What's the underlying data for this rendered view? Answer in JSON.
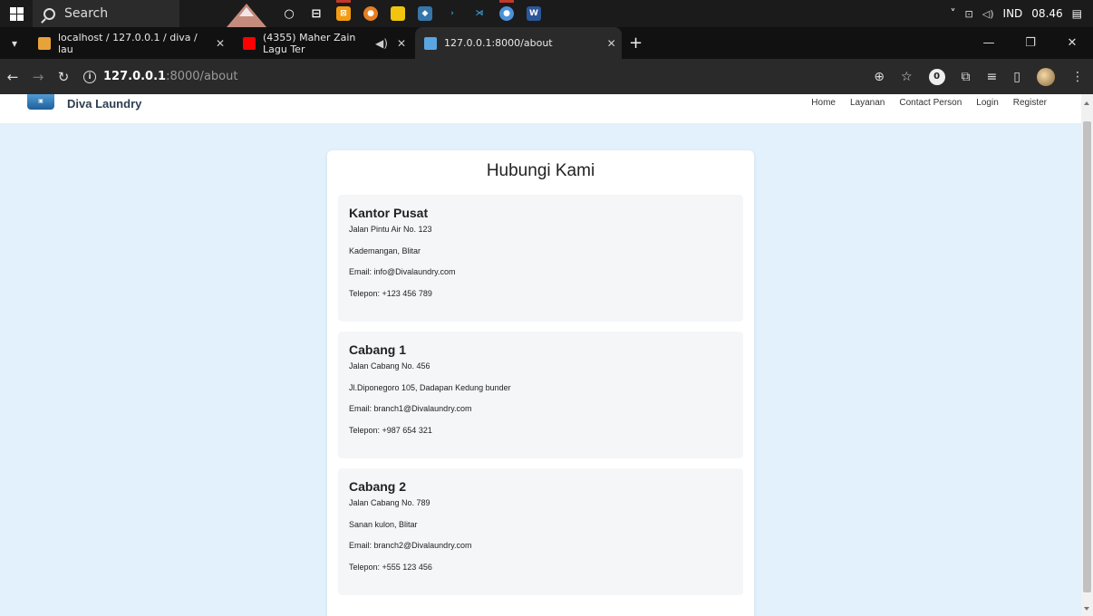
{
  "taskbar": {
    "search_placeholder": "Search",
    "tray_lang": "IND",
    "tray_time": "08.46"
  },
  "tabs": [
    {
      "label": "localhost / 127.0.0.1 / diva / lau",
      "favicon_color": "#e8a23a"
    },
    {
      "label": "(4355) Maher Zain Lagu Ter",
      "favicon_color": "#ff0000"
    },
    {
      "label": "127.0.0.1:8000/about",
      "favicon_color": "#5aa6e0"
    }
  ],
  "address_bar": {
    "url_host": "127.0.0.1",
    "url_rest": ":8000/about"
  },
  "site": {
    "brand_name": "Diva Laundry",
    "nav": [
      "Home",
      "Layanan",
      "Contact Person",
      "Login",
      "Register"
    ]
  },
  "contact": {
    "title": "Hubungi Kami",
    "offices": [
      {
        "name": "Kantor Pusat",
        "street": "Jalan Pintu Air No. 123",
        "area": "Kademangan, Blitar",
        "email": "Email: info@Divalaundry.com",
        "phone": "Telepon: +123 456 789"
      },
      {
        "name": "Cabang 1",
        "street": "Jalan Cabang No. 456",
        "area": "Jl.Diponegoro 105, Dadapan Kedung bunder",
        "email": "Email: branch1@Divalaundry.com",
        "phone": "Telepon: +987 654 321"
      },
      {
        "name": "Cabang 2",
        "street": "Jalan Cabang No. 789",
        "area": "Sanan kulon, Blitar",
        "email": "Email: branch2@Divalaundry.com",
        "phone": "Telepon: +555 123 456"
      }
    ]
  },
  "colors": {
    "page_bg": "#e2f1fb",
    "card_bg": "#ffffff",
    "office_bg": "#f5f6f8",
    "brand_text": "#2c3e50"
  }
}
